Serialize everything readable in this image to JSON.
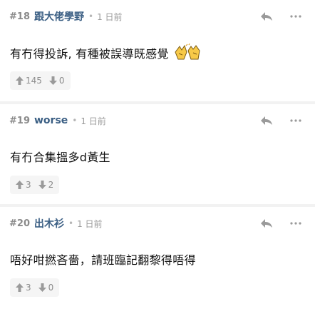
{
  "comments": [
    {
      "number": "#18",
      "username": "跟大佬學野",
      "time": "1 日前",
      "content": "有冇得投訴, 有種被誤導既感覺",
      "upvotes": "145",
      "downvotes": "0",
      "emoji": "clapping-hands-icon"
    },
    {
      "number": "#19",
      "username": "worse",
      "time": "1 日前",
      "content": "有冇合集搵多d黃生",
      "upvotes": "3",
      "downvotes": "2"
    },
    {
      "number": "#20",
      "username": "出木衫",
      "time": "1 日前",
      "content": "唔好咁撚吝嗇，請班臨記翻黎得唔得",
      "upvotes": "3",
      "downvotes": "0"
    }
  ],
  "separator": "•",
  "colors": {
    "username": "#3b5f84",
    "meta": "#9a9a9a",
    "vote_bg": "#f5f5f5",
    "gap": "#f2f2f2"
  }
}
